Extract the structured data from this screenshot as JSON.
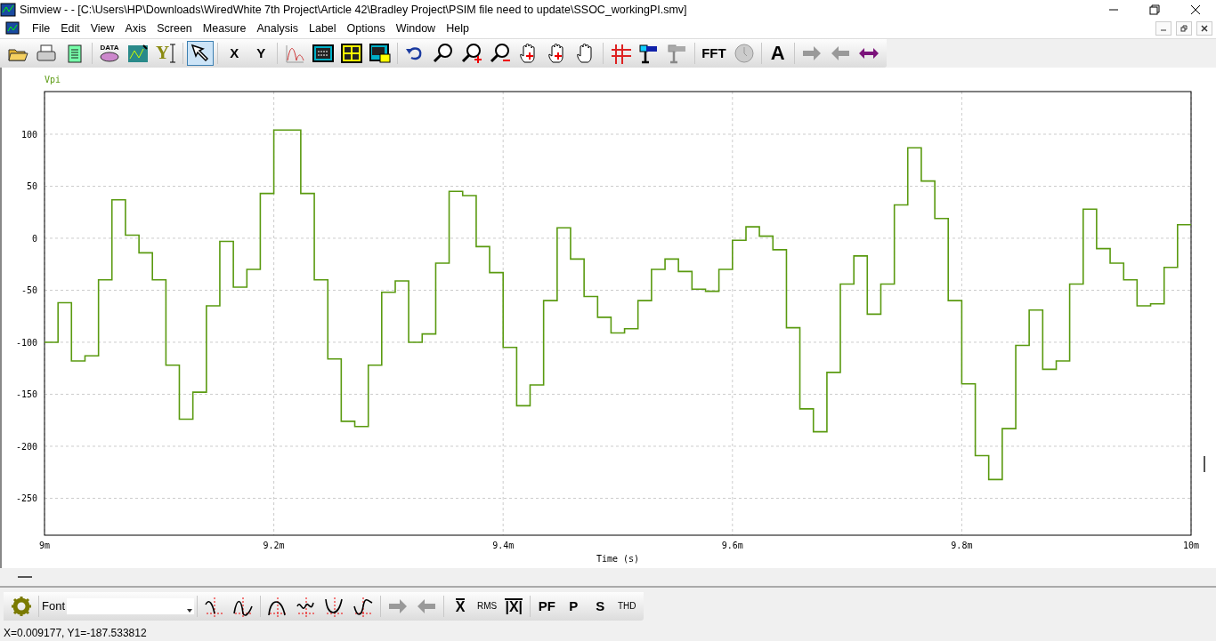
{
  "window": {
    "title": "Simview -  - [C:\\Users\\HP\\Downloads\\WiredWhite 7th Project\\Article 42\\Bradley Project\\PSIM file need to update\\SSOC_workingPI.smv]"
  },
  "menu": [
    "File",
    "Edit",
    "View",
    "Axis",
    "Screen",
    "Measure",
    "Analysis",
    "Label",
    "Options",
    "Window",
    "Help"
  ],
  "toolbar": [
    [
      {
        "kind": "open"
      },
      {
        "kind": "print"
      },
      {
        "kind": "clipboard"
      }
    ],
    [
      {
        "kind": "data",
        "label": "DATA"
      },
      {
        "kind": "chart-edit"
      },
      {
        "kind": "y-cursor",
        "label": "Y"
      }
    ],
    [
      {
        "kind": "pointer",
        "selected": true
      }
    ],
    [
      {
        "kind": "text",
        "label": "X"
      },
      {
        "kind": "text",
        "label": "Y"
      }
    ],
    [
      {
        "kind": "curve"
      },
      {
        "kind": "panel"
      },
      {
        "kind": "quad"
      },
      {
        "kind": "panel-small"
      }
    ],
    [
      {
        "kind": "undo"
      },
      {
        "kind": "zoom"
      },
      {
        "kind": "zoom-in"
      },
      {
        "kind": "zoom-out"
      },
      {
        "kind": "hand-cross"
      },
      {
        "kind": "hand-plus"
      },
      {
        "kind": "hand"
      }
    ],
    [
      {
        "kind": "grid"
      },
      {
        "kind": "probe"
      },
      {
        "kind": "probe",
        "disabled": true
      }
    ],
    [
      {
        "kind": "text",
        "label": "FFT"
      },
      {
        "kind": "clock",
        "disabled": true
      }
    ],
    [
      {
        "kind": "big-text",
        "label": "A"
      }
    ],
    [
      {
        "kind": "arrow-right",
        "disabled": true
      },
      {
        "kind": "arrow-left",
        "disabled": true
      },
      {
        "kind": "double-arrow",
        "disabled": false
      }
    ]
  ],
  "chart": {
    "chart_data": {
      "type": "line",
      "grid": true,
      "xlabel": "Time (s)",
      "xlim": [
        9,
        10
      ],
      "ylim": [
        -285.5,
        141
      ],
      "xticks": [
        {
          "value": 9,
          "label": "9m"
        },
        {
          "value": 9.2,
          "label": "9.2m"
        },
        {
          "value": 9.4,
          "label": "9.4m"
        },
        {
          "value": 9.6,
          "label": "9.6m"
        },
        {
          "value": 9.8,
          "label": "9.8m"
        },
        {
          "value": 10,
          "label": "10m"
        }
      ],
      "yticks": [
        100,
        50,
        0,
        -50,
        -100,
        -150,
        -200,
        -250
      ],
      "x": [
        9,
        9.0118,
        9.0118,
        9.0235,
        9.0235,
        9.0353,
        9.0353,
        9.0471,
        9.0471,
        9.0588,
        9.0588,
        9.0706,
        9.0706,
        9.0824,
        9.0824,
        9.0941,
        9.0941,
        9.1059,
        9.1059,
        9.1176,
        9.1176,
        9.1294,
        9.1294,
        9.1412,
        9.1412,
        9.1529,
        9.1529,
        9.1647,
        9.1647,
        9.1765,
        9.1765,
        9.1882,
        9.1882,
        9.2,
        9.2,
        9.2118,
        9.2118,
        9.2235,
        9.2235,
        9.2353,
        9.2353,
        9.2471,
        9.2471,
        9.2588,
        9.2588,
        9.2706,
        9.2706,
        9.2824,
        9.2824,
        9.2941,
        9.2941,
        9.3059,
        9.3059,
        9.3176,
        9.3176,
        9.3294,
        9.3294,
        9.3412,
        9.3412,
        9.3529,
        9.3529,
        9.3647,
        9.3647,
        9.3765,
        9.3765,
        9.3882,
        9.3882,
        9.4,
        9.4,
        9.4118,
        9.4118,
        9.4235,
        9.4235,
        9.4353,
        9.4353,
        9.4471,
        9.4471,
        9.4588,
        9.4588,
        9.4706,
        9.4706,
        9.4824,
        9.4824,
        9.4941,
        9.4941,
        9.5059,
        9.5059,
        9.5176,
        9.5176,
        9.5294,
        9.5294,
        9.5412,
        9.5412,
        9.5529,
        9.5529,
        9.5647,
        9.5647,
        9.5765,
        9.5765,
        9.5882,
        9.5882,
        9.6,
        9.6,
        9.6118,
        9.6118,
        9.6235,
        9.6235,
        9.6353,
        9.6353,
        9.6471,
        9.6471,
        9.6588,
        9.6588,
        9.6706,
        9.6706,
        9.6824,
        9.6824,
        9.6941,
        9.6941,
        9.7059,
        9.7059,
        9.7176,
        9.7176,
        9.7294,
        9.7294,
        9.7412,
        9.7412,
        9.7529,
        9.7529,
        9.7647,
        9.7647,
        9.7765,
        9.7765,
        9.7882,
        9.7882,
        9.8,
        9.8,
        9.8118,
        9.8118,
        9.8235,
        9.8235,
        9.8353,
        9.8353,
        9.8471,
        9.8471,
        9.8588,
        9.8588,
        9.8706,
        9.8706,
        9.8824,
        9.8824,
        9.8941,
        9.8941,
        9.9059,
        9.9059,
        9.9176,
        9.9176,
        9.9294,
        9.9294,
        9.9412,
        9.9412,
        9.9529,
        9.9529,
        9.9647,
        9.9647,
        9.9765,
        9.9765,
        9.9882,
        9.9882,
        10
      ],
      "series": [
        {
          "name": "Vpi",
          "color": "#5a9a10",
          "values": [
            -100,
            -100,
            -62,
            -62,
            -118,
            -118,
            -113,
            -113,
            -40,
            -40,
            37,
            37,
            3,
            3,
            -14,
            -14,
            -40,
            -40,
            -122,
            -122,
            -174,
            -174,
            -148,
            -148,
            -65,
            -65,
            -3,
            -3,
            -47,
            -47,
            -30,
            -30,
            43,
            43,
            104,
            104,
            104,
            104,
            43,
            43,
            -40,
            -40,
            -116,
            -116,
            -176,
            -176,
            -181,
            -181,
            -122,
            -122,
            -52,
            -52,
            -41,
            -41,
            -100,
            -100,
            -92,
            -92,
            -24,
            -24,
            45,
            45,
            41,
            41,
            -8,
            -8,
            -33,
            -33,
            -105,
            -105,
            -161,
            -161,
            -141,
            -141,
            -60,
            -60,
            10,
            10,
            -20,
            -20,
            -56,
            -56,
            -76,
            -76,
            -91,
            -91,
            -87,
            -87,
            -60,
            -60,
            -30,
            -30,
            -20,
            -20,
            -32,
            -32,
            -49,
            -49,
            -51,
            -51,
            -30,
            -30,
            -2,
            -2,
            11,
            11,
            2,
            2,
            -11,
            -11,
            -86,
            -86,
            -164,
            -164,
            -186,
            -186,
            -129,
            -129,
            -44,
            -44,
            -17,
            -17,
            -73,
            -73,
            -44,
            -44,
            32,
            32,
            87,
            87,
            55,
            55,
            19,
            19,
            -60,
            -60,
            -140,
            -140,
            -209,
            -209,
            -232,
            -232,
            -183,
            -183,
            -103,
            -103,
            -69,
            -69,
            -126,
            -126,
            -118,
            -118,
            -44,
            -44,
            28,
            28,
            -10,
            -10,
            -24,
            -24,
            -40,
            -40,
            -65,
            -65,
            -63,
            -63,
            -28,
            -28,
            13,
            13
          ]
        }
      ]
    }
  },
  "bottom_toolbar": [
    [
      {
        "kind": "gear"
      }
    ],
    [
      {
        "kind": "font",
        "label": "Font"
      }
    ],
    [
      {
        "kind": "wave-a"
      },
      {
        "kind": "wave-b"
      }
    ],
    [
      {
        "kind": "wave-c"
      },
      {
        "kind": "wave-d"
      },
      {
        "kind": "wave-e"
      },
      {
        "kind": "wave-f"
      }
    ],
    [
      {
        "kind": "arrow-right",
        "disabled": true
      },
      {
        "kind": "arrow-left",
        "disabled": true
      }
    ],
    [
      {
        "kind": "overline",
        "label": "X"
      },
      {
        "kind": "small-text",
        "label": "RMS"
      },
      {
        "kind": "overline",
        "label": "|X|"
      }
    ],
    [
      {
        "kind": "text",
        "label": "PF"
      },
      {
        "kind": "text",
        "label": "P"
      },
      {
        "kind": "text",
        "label": "S"
      },
      {
        "kind": "small-text",
        "label": "THD"
      }
    ]
  ],
  "status_bar": "X=0.009177, Y1=-187.533812"
}
